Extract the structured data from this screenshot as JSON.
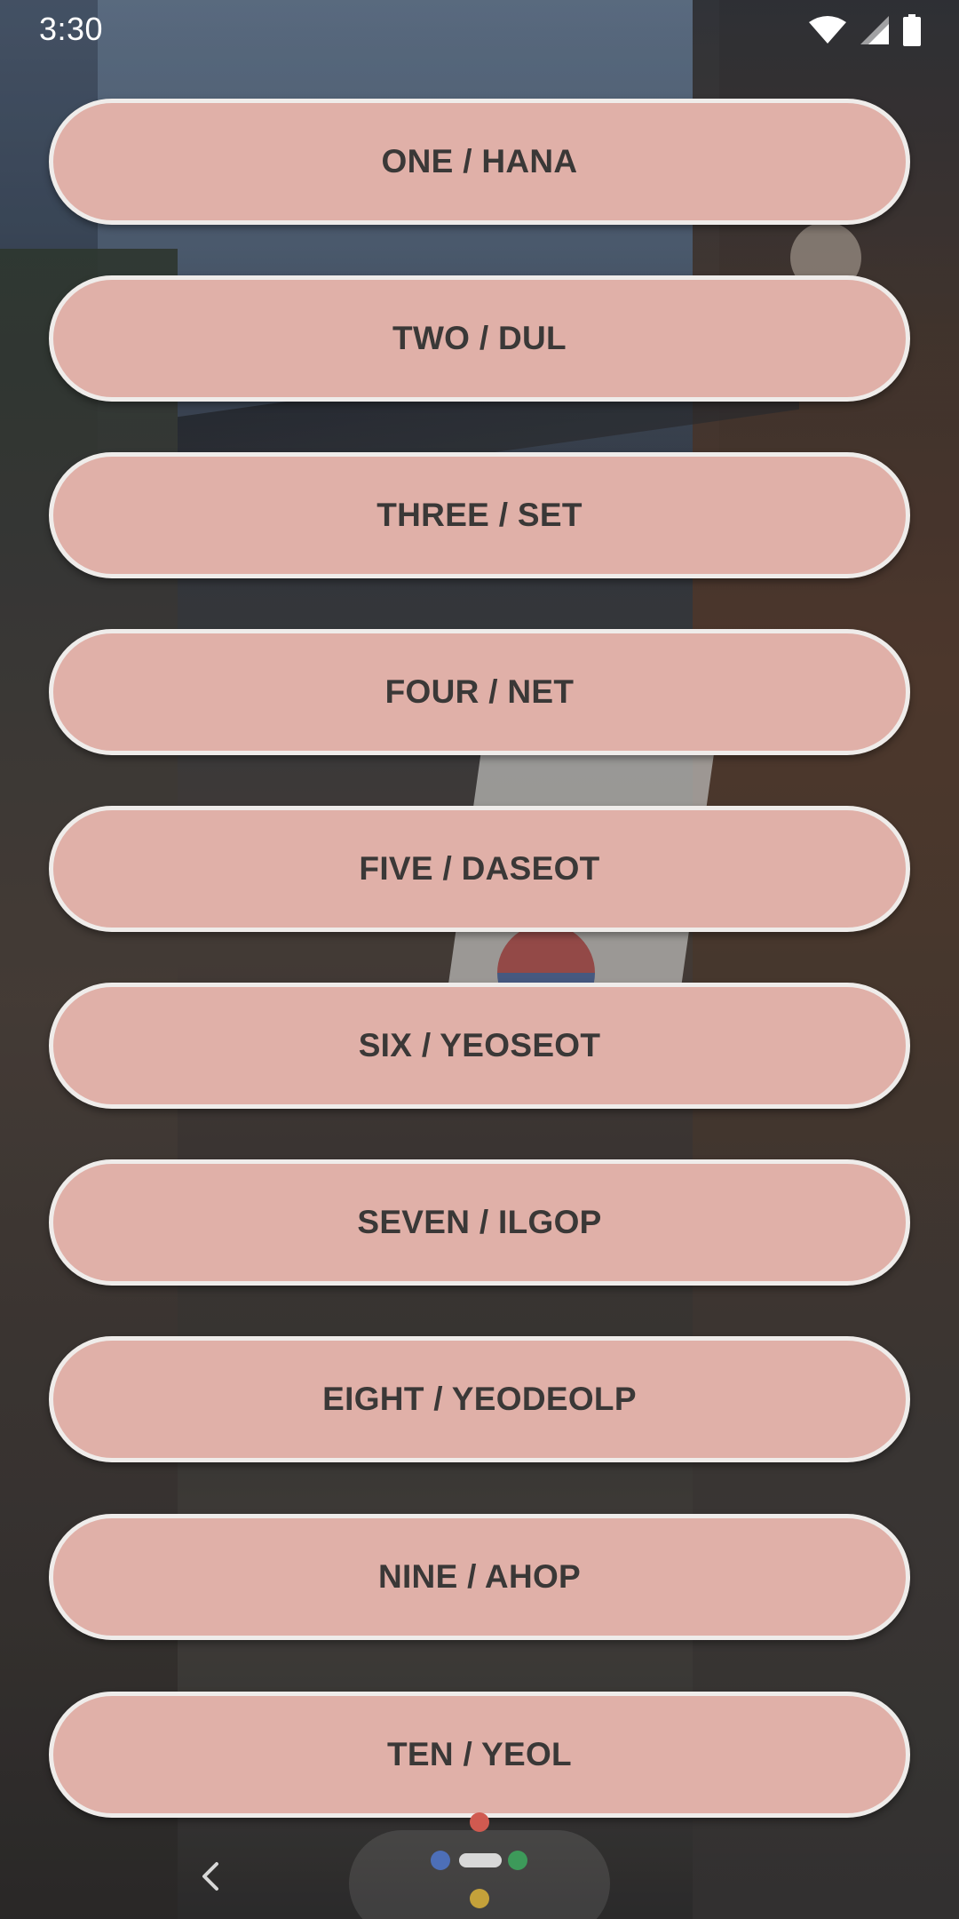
{
  "status_bar": {
    "time": "3:30",
    "icons": [
      "wifi-icon",
      "cellular-signal-icon",
      "battery-icon"
    ]
  },
  "colors": {
    "button_fill": "#e0b0a8",
    "button_border": "#efecea",
    "button_text": "#3a3837"
  },
  "buttons": [
    {
      "label": "ONE / HANA"
    },
    {
      "label": "TWO / DUL"
    },
    {
      "label": "THREE / SET"
    },
    {
      "label": "FOUR / NET"
    },
    {
      "label": "FIVE / DASEOT"
    },
    {
      "label": "SIX / YEOSEOT"
    },
    {
      "label": "SEVEN / ILGOP"
    },
    {
      "label": "EIGHT / YEODEOLP"
    },
    {
      "label": "NINE / AHOP"
    },
    {
      "label": "TEN / YEOL"
    }
  ],
  "nav_bar": {
    "icons": [
      "back-icon",
      "home-pill-icon",
      "assistant-dots-icon"
    ]
  }
}
